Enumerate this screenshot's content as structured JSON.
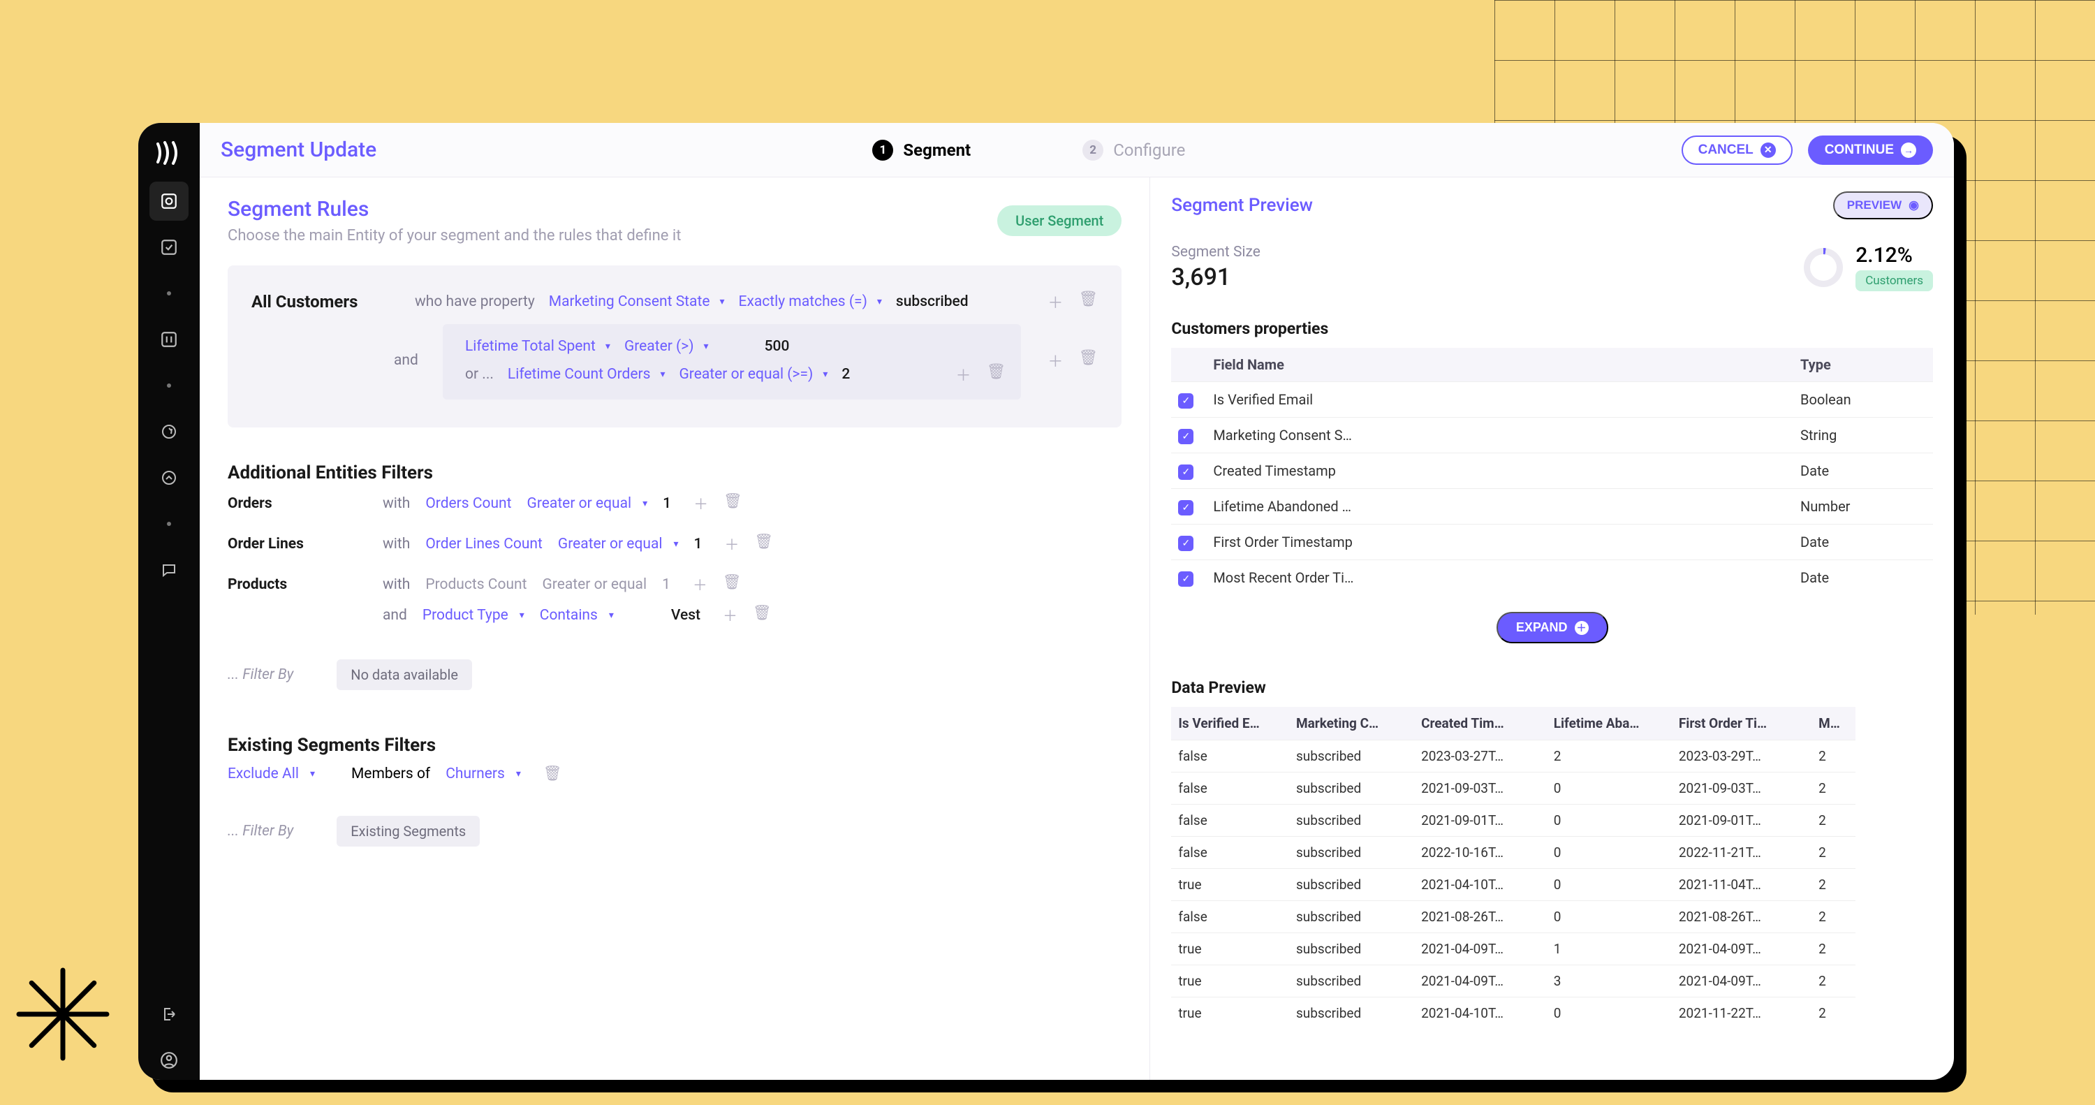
{
  "page": {
    "title": "Segment Update"
  },
  "stepper": {
    "step1_num": "1",
    "step1_label": "Segment",
    "step2_num": "2",
    "step2_label": "Configure"
  },
  "actions": {
    "cancel": "CANCEL",
    "continue": "CONTINUE"
  },
  "rules": {
    "title": "Segment Rules",
    "subtitle": "Choose the main Entity of your segment and the rules that define it",
    "badge": "User Segment",
    "entity": "All Customers",
    "who": "who have property",
    "prop1": "Marketing Consent State",
    "op1": "Exactly matches (=)",
    "val1": "subscribed",
    "and": "and",
    "prop2": "Lifetime Total Spent",
    "op2": "Greater (>)",
    "val2": "500",
    "or": "or ...",
    "prop3": "Lifetime Count Orders",
    "op3": "Greater or equal (>=)",
    "val3": "2"
  },
  "additional": {
    "title": "Additional Entities Filters",
    "orders": {
      "label": "Orders",
      "with": "with",
      "prop": "Orders Count",
      "op": "Greater or equal",
      "val": "1"
    },
    "orderlines": {
      "label": "Order Lines",
      "with": "with",
      "prop": "Order Lines Count",
      "op": "Greater or equal",
      "val": "1"
    },
    "products": {
      "label": "Products",
      "with": "with",
      "prop": "Products Count",
      "op": "Greater or equal",
      "val": "1",
      "and": "and",
      "prop2": "Product Type",
      "op2": "Contains",
      "val2": "Vest"
    },
    "filter_by_placeholder": "... Filter By",
    "nodata": "No data available"
  },
  "existing": {
    "title": "Existing Segments Filters",
    "exclude": "Exclude All",
    "members": "Members of",
    "segment": "Churners",
    "filter_by_placeholder": "... Filter By",
    "chip": "Existing Segments"
  },
  "preview": {
    "title": "Segment Preview",
    "btn": "PREVIEW",
    "size_label": "Segment Size",
    "size": "3,691",
    "pct": "2.12%",
    "pct_badge": "Customers",
    "props_title": "Customers properties",
    "cols": {
      "field": "Field Name",
      "type": "Type"
    },
    "props": [
      {
        "name": "Is Verified Email",
        "type": "Boolean"
      },
      {
        "name": "Marketing Consent S…",
        "type": "String"
      },
      {
        "name": "Created Timestamp",
        "type": "Date"
      },
      {
        "name": "Lifetime Abandoned …",
        "type": "Number"
      },
      {
        "name": "First Order Timestamp",
        "type": "Date"
      },
      {
        "name": "Most Recent Order Ti…",
        "type": "Date"
      }
    ],
    "expand": "EXPAND",
    "data_title": "Data Preview",
    "dcols": {
      "c1": "Is Verified E…",
      "c2": "Marketing C…",
      "c3": "Created Tim…",
      "c4": "Lifetime Aba…",
      "c5": "First Order Ti…",
      "c6": "M…"
    },
    "rows": [
      {
        "c1": "false",
        "c2": "subscribed",
        "c3": "2023-03-27T…",
        "c4": "2",
        "c5": "2023-03-29T…",
        "c6": "2"
      },
      {
        "c1": "false",
        "c2": "subscribed",
        "c3": "2021-09-03T…",
        "c4": "0",
        "c5": "2021-09-03T…",
        "c6": "2"
      },
      {
        "c1": "false",
        "c2": "subscribed",
        "c3": "2021-09-01T…",
        "c4": "0",
        "c5": "2021-09-01T…",
        "c6": "2"
      },
      {
        "c1": "false",
        "c2": "subscribed",
        "c3": "2022-10-16T…",
        "c4": "0",
        "c5": "2022-11-21T…",
        "c6": "2"
      },
      {
        "c1": "true",
        "c2": "subscribed",
        "c3": "2021-04-10T…",
        "c4": "0",
        "c5": "2021-11-04T…",
        "c6": "2"
      },
      {
        "c1": "false",
        "c2": "subscribed",
        "c3": "2021-08-26T…",
        "c4": "0",
        "c5": "2021-08-26T…",
        "c6": "2"
      },
      {
        "c1": "true",
        "c2": "subscribed",
        "c3": "2021-04-09T…",
        "c4": "1",
        "c5": "2021-04-09T…",
        "c6": "2"
      },
      {
        "c1": "true",
        "c2": "subscribed",
        "c3": "2021-04-09T…",
        "c4": "3",
        "c5": "2021-04-09T…",
        "c6": "2"
      },
      {
        "c1": "true",
        "c2": "subscribed",
        "c3": "2021-04-10T…",
        "c4": "0",
        "c5": "2021-11-22T…",
        "c6": "2"
      }
    ]
  }
}
